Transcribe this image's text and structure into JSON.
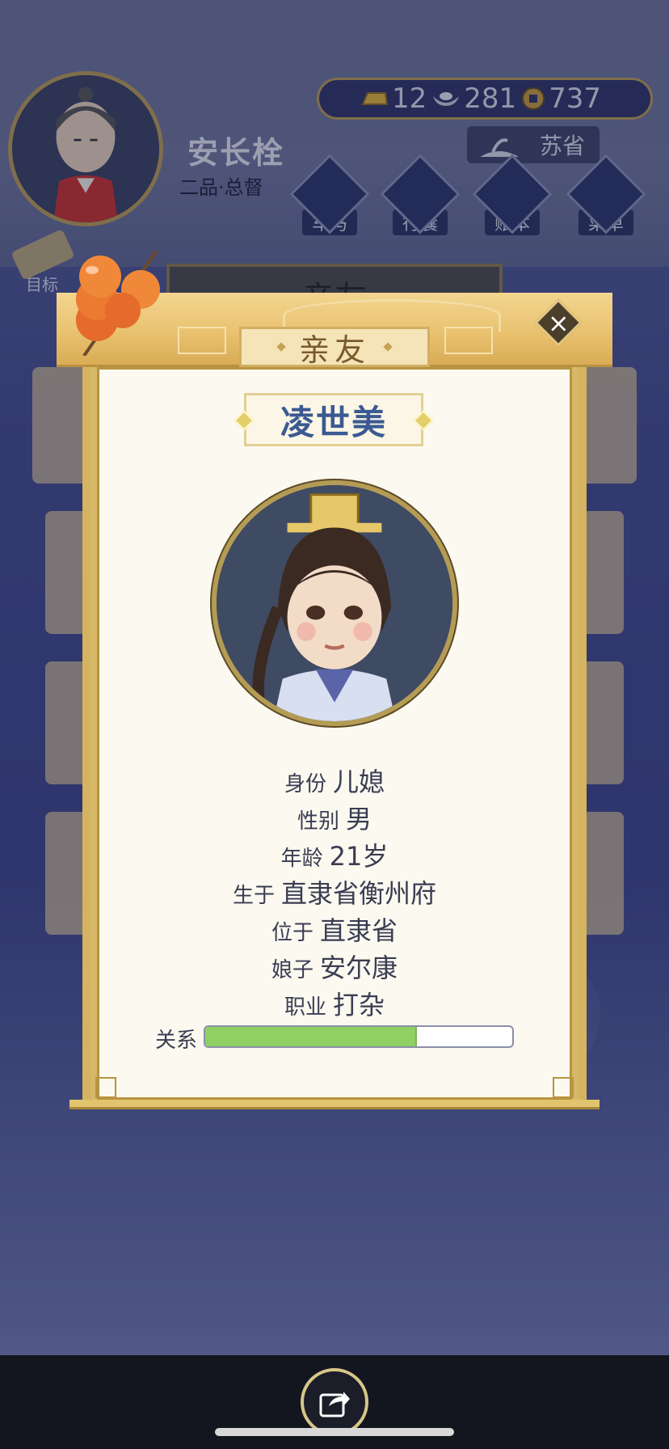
{
  "player": {
    "name": "安长栓",
    "rank": "二品·总督"
  },
  "currency": {
    "gold": "12",
    "silver": "281",
    "coins": "737"
  },
  "location": "苏省",
  "hud_buttons": [
    {
      "label": "车马",
      "icon": "carriage-icon"
    },
    {
      "label": "行囊",
      "icon": "bag-icon"
    },
    {
      "label": "账本",
      "icon": "ledger-icon"
    },
    {
      "label": "菜单",
      "icon": "menu-dots-icon"
    }
  ],
  "goal_label": "目标",
  "behind_title": "亲友",
  "modal": {
    "title": "亲友",
    "close_icon": "close-icon"
  },
  "relative": {
    "name": "凌世美",
    "fields": [
      {
        "key": "身份",
        "value": "儿媳"
      },
      {
        "key": "性别",
        "value": "男"
      },
      {
        "key": "年龄",
        "value": "21岁"
      },
      {
        "key": "生于",
        "value": "直隶省衡州府"
      },
      {
        "key": "位于",
        "value": "直隶省"
      },
      {
        "key": "娘子",
        "value": "安尔康"
      },
      {
        "key": "职业",
        "value": "打杂"
      }
    ],
    "relation_label": "关系",
    "relation_level": 0.69
  },
  "colors": {
    "accent_gold": "#d4b460",
    "name_blue": "#3b5a92",
    "relation_green": "#8fcf64"
  }
}
